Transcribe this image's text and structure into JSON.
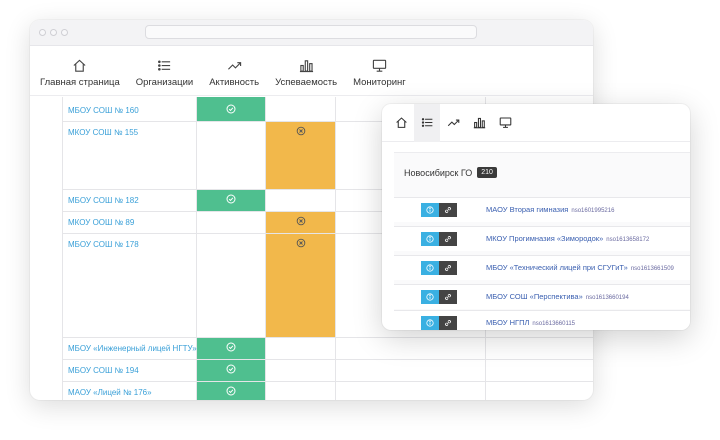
{
  "back_window": {
    "nav": [
      {
        "label": "Главная страница",
        "icon": "home-icon"
      },
      {
        "label": "Организации",
        "icon": "list-icon"
      },
      {
        "label": "Активность",
        "icon": "trend-icon"
      },
      {
        "label": "Успеваемость",
        "icon": "bar-chart-icon"
      },
      {
        "label": "Мониторинг",
        "icon": "monitor-icon"
      }
    ],
    "rows": [
      {
        "name": "МБОУ СОШ № 160",
        "status": "green"
      },
      {
        "name": "МКОУ СОШ № 155",
        "status": "orange"
      },
      {
        "name": "МБОУ СОШ № 182",
        "status": "green"
      },
      {
        "name": "МКОУ ООШ № 89",
        "status": "orange"
      },
      {
        "name": "МБОУ СОШ № 178",
        "status": "orange"
      },
      {
        "name": "МБОУ «Инженерный лицей НГТУ»",
        "status": "green"
      },
      {
        "name": "МБОУ СОШ № 194",
        "status": "green"
      },
      {
        "name": "МАОУ «Лицей № 176»",
        "status": "green"
      }
    ]
  },
  "front_window": {
    "tabs": [
      "home-icon",
      "list-icon",
      "trend-icon",
      "bar-chart-icon",
      "monitor-icon"
    ],
    "active_tab": "list-icon",
    "region_name": "Новосибирск ГО",
    "region_count": "210",
    "orgs": [
      {
        "name": "МАОУ Вторая гимназия",
        "code": "nso1601995216"
      },
      {
        "name": "МКОУ Прогимназия «Зимородок»",
        "code": "nso1613658172"
      },
      {
        "name": "МБОУ «Технический лицей при СГУГиТ»",
        "code": "nso1613661509"
      },
      {
        "name": "МБОУ СОШ «Перспектива»",
        "code": "nso1613660194"
      },
      {
        "name": "МБОУ НГПЛ",
        "code": "nso1613660115"
      }
    ]
  },
  "colors": {
    "green": "#4fbf8f",
    "orange": "#f2b84b",
    "link": "#3aa0d8",
    "info": "#3ab0e2"
  }
}
